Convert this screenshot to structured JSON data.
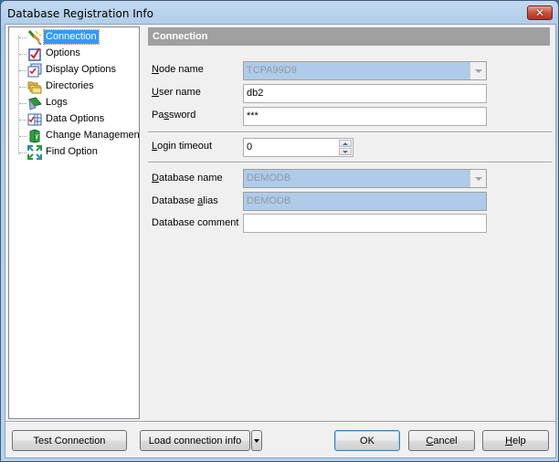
{
  "window": {
    "title": "Database Registration Info",
    "close_icon": "close-icon"
  },
  "tree": {
    "items": [
      {
        "label": "Connection",
        "icon": "plug-icon",
        "selected": true
      },
      {
        "label": "Options",
        "icon": "checkbox-icon"
      },
      {
        "label": "Display Options",
        "icon": "display-options-icon"
      },
      {
        "label": "Directories",
        "icon": "folders-icon"
      },
      {
        "label": "Logs",
        "icon": "logs-icon"
      },
      {
        "label": "Data Options",
        "icon": "data-grid-icon"
      },
      {
        "label": "Change Managemen",
        "icon": "change-management-icon"
      },
      {
        "label": "Find Option",
        "icon": "find-option-icon"
      }
    ]
  },
  "section": {
    "title": "Connection"
  },
  "form": {
    "node_name": {
      "label_pre": "",
      "label_accel": "N",
      "label_post": "ode name",
      "value": "TCPA99D9"
    },
    "user_name": {
      "label_pre": "",
      "label_accel": "U",
      "label_post": "ser name",
      "value": "db2"
    },
    "password": {
      "label_pre": "Pa",
      "label_accel": "s",
      "label_post": "sword",
      "value": "***"
    },
    "login_timeout": {
      "label_pre": "",
      "label_accel": "L",
      "label_post": "ogin timeout",
      "value": "0"
    },
    "database_name": {
      "label_pre": "",
      "label_accel": "D",
      "label_post": "atabase name",
      "value": "DEMODB"
    },
    "database_alias": {
      "label_pre": "Database ",
      "label_accel": "a",
      "label_post": "lias",
      "value": "DEMODB"
    },
    "database_comment": {
      "label": "Database comment",
      "value": ""
    }
  },
  "buttons": {
    "test_connection": "Test Connection",
    "load_connection_info": "Load connection info",
    "ok": "OK",
    "cancel_accel": "C",
    "cancel_rest": "ancel",
    "help_accel": "H",
    "help_rest": "elp"
  }
}
